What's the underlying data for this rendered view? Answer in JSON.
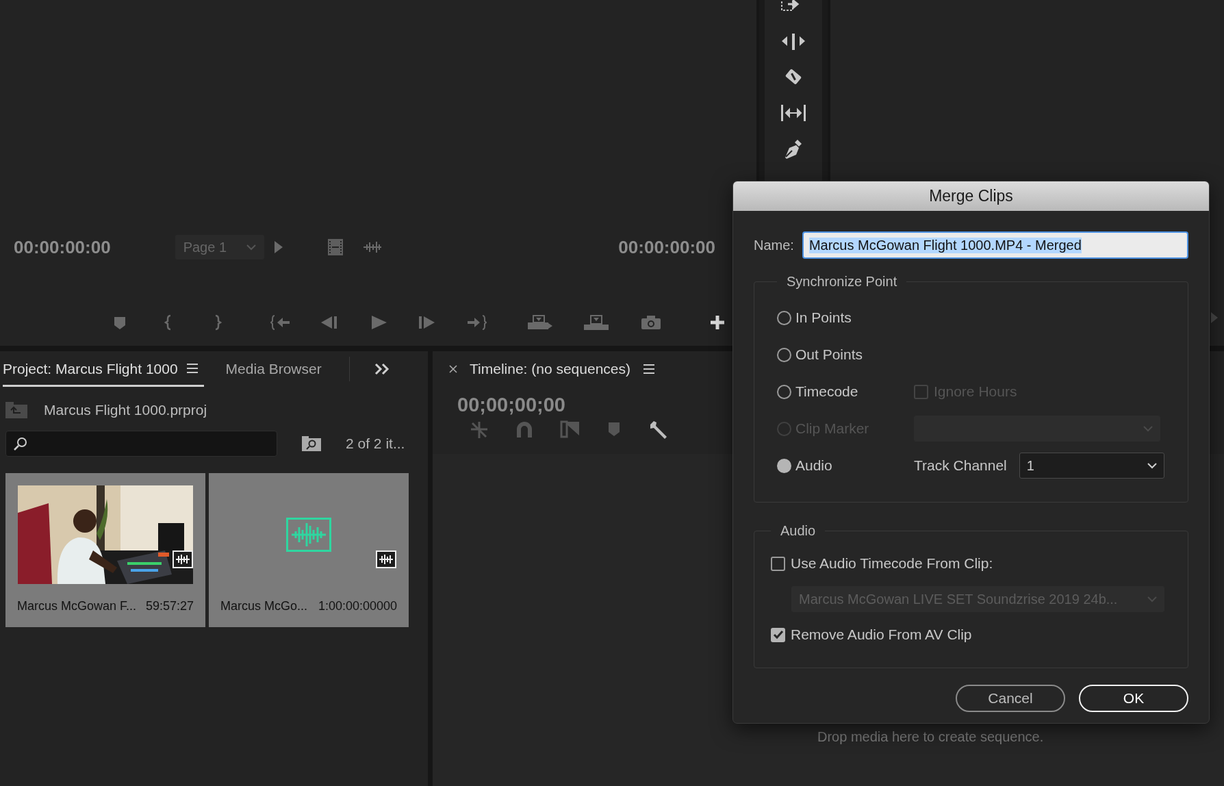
{
  "source_monitor": {
    "timecode_left": "00:00:00:00",
    "page_dropdown": "Page 1",
    "timecode_right": "00:00:00:00"
  },
  "project_panel": {
    "tabs": [
      {
        "label": "Project: Marcus Flight 1000",
        "selected": true
      },
      {
        "label": "Media Browser",
        "selected": false
      }
    ],
    "project_file": "Marcus Flight 1000.prproj",
    "item_count": "2 of 2 it...",
    "items": [
      {
        "kind": "video",
        "name": "Marcus McGowan F...",
        "duration": "59:57:27"
      },
      {
        "kind": "audio",
        "name": "Marcus McGo...",
        "duration": "1:00:00:00000"
      }
    ]
  },
  "timeline": {
    "title": "Timeline: (no sequences)",
    "timecode": "00;00;00;00",
    "empty_message": "Drop media here to create sequence."
  },
  "dialog": {
    "title": "Merge Clips",
    "name_label": "Name:",
    "name_value": "Marcus McGowan Flight 1000.MP4 - Merged",
    "name_text_selected": true,
    "sync_group": "Synchronize Point",
    "sync_options": [
      {
        "label": "In Points",
        "selected": false,
        "disabled": false
      },
      {
        "label": "Out Points",
        "selected": false,
        "disabled": false
      },
      {
        "label": "Timecode",
        "selected": false,
        "disabled": false,
        "extra": {
          "kind": "checkbox",
          "label": "Ignore Hours",
          "checked": false,
          "disabled": true
        }
      },
      {
        "label": "Clip Marker",
        "selected": false,
        "disabled": true,
        "extra": {
          "kind": "dropdown",
          "disabled": true
        }
      },
      {
        "label": "Audio",
        "selected": true,
        "disabled": false,
        "extra": {
          "kind": "dropdown",
          "label": "Track Channel",
          "value": "1",
          "disabled": false
        }
      }
    ],
    "audio_group": "Audio",
    "use_audio_timecode": {
      "label": "Use Audio Timecode From Clip:",
      "checked": false
    },
    "clip_dropdown": {
      "value": "Marcus McGowan LIVE SET Soundzrise 2019 24b...",
      "disabled": true
    },
    "remove_audio": {
      "label": "Remove Audio From AV Clip",
      "checked": true
    },
    "buttons": [
      {
        "label": "Cancel",
        "default": false
      },
      {
        "label": "OK",
        "default": true
      }
    ]
  }
}
